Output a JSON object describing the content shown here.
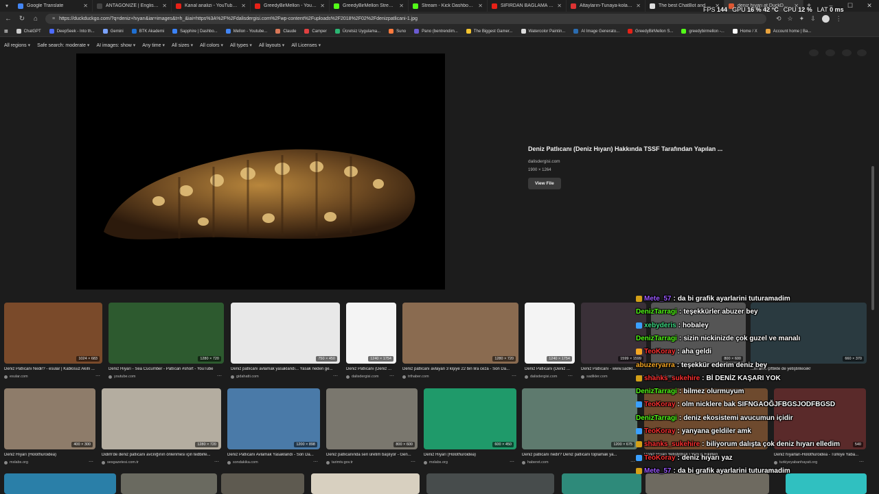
{
  "tabs": [
    {
      "label": "Google Translate",
      "color": "#4285f4"
    },
    {
      "label": "ANTAGONIZE | English meaning",
      "color": "#444"
    },
    {
      "label": "Kanal analizi - YouTube Studio",
      "color": "#e62117"
    },
    {
      "label": "GreedyBirMellon - YouTube",
      "color": "#e62117"
    },
    {
      "label": "GreedyBirMellon Stream - Watch",
      "color": "#53fc18"
    },
    {
      "label": "Stream - Kick Dashboard",
      "color": "#53fc18"
    },
    {
      "label": "SIFIRDAN BAĞLAMA DERSLERİ",
      "color": "#e62117"
    },
    {
      "label": "Altayların-Tunaya-kolay-nota",
      "color": "#d33"
    },
    {
      "label": "The best ChatBot and Widgets f",
      "color": "#ddd"
    },
    {
      "label": "deniz hıyarı at DuckDuckGo",
      "color": "#de5833"
    }
  ],
  "address": {
    "url": "https://duckduckgo.com/?q=deniz+hıyarı&iar=images&t=h_&iai=https%3A%2F%2Fdalisdergisi.com%2Fwp-content%2Fuploads%2F2018%2F02%2Fdenizpatlicani-1.jpg"
  },
  "bookmarks": [
    {
      "label": "ChatGPT",
      "color": "#ccc"
    },
    {
      "label": "DeepSeek - Into th...",
      "color": "#4d6bfe"
    },
    {
      "label": "Gemini",
      "color": "#7aa2ff"
    },
    {
      "label": "BTK Akademi",
      "color": "#1f6fd1"
    },
    {
      "label": "Sapphire | Dashbo...",
      "color": "#3b82f6"
    },
    {
      "label": "Mellon - Youtube...",
      "color": "#4285f4"
    },
    {
      "label": "Claude",
      "color": "#d97757"
    },
    {
      "label": "Camper",
      "color": "#e04040"
    },
    {
      "label": "Ücretsiz Uygulama...",
      "color": "#2bb673"
    },
    {
      "label": "Suno",
      "color": "#ff7a3d"
    },
    {
      "label": "Pano (bentrendim...",
      "color": "#6b5bd2"
    },
    {
      "label": "The Biggest Gamer...",
      "color": "#f4c430"
    },
    {
      "label": "Watercolor Paintin...",
      "color": "#ddd"
    },
    {
      "label": "AI Image Generato...",
      "color": "#2b6cb0"
    },
    {
      "label": "GreedyBirMellon S...",
      "color": "#e62117"
    },
    {
      "label": "greedybirmellon -...",
      "color": "#53fc18"
    },
    {
      "label": "Home / X",
      "color": "#fff"
    },
    {
      "label": "Account home | Ba...",
      "color": "#e8a33d"
    }
  ],
  "filters": [
    "All regions",
    "Safe search: moderate",
    "AI images: show",
    "Any time",
    "All sizes",
    "All colors",
    "All types",
    "All layouts",
    "All Licenses"
  ],
  "preview": {
    "title": "Deniz Patlıcanı (Deniz Hıyarı) Hakkında TSSF Tarafından Yapılan ...",
    "domain": "dalisdergisi.com",
    "size": "1900 × 1264",
    "view_file": "View File"
  },
  "row1": [
    {
      "dims": "1024 × 683",
      "caption": "Deniz Patlıcanı Nedir? - esular | Kablosuz Akıllı ...",
      "source": "esular.com"
    },
    {
      "dims": "1280 × 720",
      "caption": "Deniz Hıyarı - Sea Cucumber - Patlıcan #short - YouTube",
      "source": "youtube.com"
    },
    {
      "dims": "750 × 450",
      "caption": "Deniz patlıcanı avlamak yasaklandı... Yasak neden ge...",
      "source": "gidahatti.com"
    },
    {
      "dims": "1240 × 1754",
      "caption": "Deniz Patlıcanı (Deniz ...",
      "source": "dalisdergisi.com"
    },
    {
      "dims": "1280 × 720",
      "caption": "Deniz patlıcanı avlayan 3 kişiye 22 bin lira ceza - Son Da...",
      "source": "trthaber.com"
    },
    {
      "dims": "1240 × 1754",
      "caption": "Deniz Patlıcanı (Deniz ...",
      "source": "dalisdergisi.com"
    },
    {
      "dims": "1599 × 1599",
      "caption": "Deniz Patlıcanı - www.sadikl...",
      "source": "sadikler.com"
    },
    {
      "dims": "800 × 600",
      "caption": "",
      "source": "lirzzet.com"
    },
    {
      "dims": "660 × 370",
      "caption": "...nı artık çiftlikte de yetiştirilecek!",
      "source": ""
    }
  ],
  "row2": [
    {
      "dims": "400 × 300",
      "caption": "Deniz Hıyarı (Holothuroidea)",
      "source": "mxlabs.org"
    },
    {
      "dims": "1280 × 720",
      "caption": "Didim'de deniz patlıcanı avcılığının önlenmesi için tedbirle...",
      "source": "sesgazetesi.com.tr"
    },
    {
      "dims": "1200 × 898",
      "caption": "Deniz Patlıcanı Avlamak Yasaklandı - Son Da...",
      "source": "sondakika.com"
    },
    {
      "dims": "800 × 600",
      "caption": "Deniz patlıcanında seri üretim başlıyor - Gen...",
      "source": "tarimtv.gov.tr"
    },
    {
      "dims": "600 × 450",
      "caption": "Deniz Hıyarı (Holothuroidea)",
      "source": "mxlabs.org"
    },
    {
      "dims": "1200 × 675",
      "caption": "Deniz patlıcanı nedir? Deniz patlıcanı toplamak ya...",
      "source": "haberet.com"
    },
    {
      "dims": "",
      "caption": "Deniz Hıyarı Yetiştirmek | Yeni iş Fikirleri",
      "source": ""
    },
    {
      "dims": "540",
      "caption": "Deniz hıyarları-Holothuroidea - Türkiye Yaba...",
      "source": "turkiyeyabanhayati.org"
    }
  ],
  "stats": {
    "fps_label": "FPS",
    "fps": "144",
    "gpu_label": "GPU",
    "gpu": "16 %",
    "gpu_temp": "42 °C",
    "cpu_label": "CPU",
    "cpu": "12 %",
    "lat_label": "LAT",
    "lat": "0 ms"
  },
  "chat": [
    {
      "user": "Mete_57",
      "sep": " : ",
      "msg": "da bi grafik ayarlarini tuturamadim",
      "color": "#9b59ff",
      "badge": "#d4a017"
    },
    {
      "user": "DenizTarragi",
      "sep": " : ",
      "msg": "teşekkürler abuzer bey",
      "color": "#53fc18",
      "badge": ""
    },
    {
      "user": "xebyderis",
      "sep": " : ",
      "msg": "hobaley",
      "color": "#3ddc84",
      "badge": "#3aa0ff"
    },
    {
      "user": "DenizTarragi",
      "sep": " : ",
      "msg": "sizin nickinizde çok guzel ve manalı",
      "color": "#53fc18",
      "badge": ""
    },
    {
      "user": "TeoKoray",
      "sep": " : ",
      "msg": "aha geldi",
      "color": "#ff3030",
      "badge": "#f5a623"
    },
    {
      "user": "abuzeryarra",
      "sep": " : ",
      "msg": "teşekkür ederim deniz bey",
      "color": "#f5a623",
      "badge": ""
    },
    {
      "user": "shanks_sukehire",
      "sep": " : ",
      "msg": "Bİ DENİZ KAŞARI YOK",
      "color": "#ff3030",
      "badge": "#d4a017"
    },
    {
      "user": "DenizTarragi",
      "sep": " : ",
      "msg": "bilmez olurmuyum",
      "color": "#53fc18",
      "badge": ""
    },
    {
      "user": "TeoKoray",
      "sep": " : ",
      "msg": "olm nicklere bak SIFNGAOĞJFBGSJODFBGSD",
      "color": "#ff3030",
      "badge": "#3aa0ff"
    },
    {
      "user": "DenizTarragi",
      "sep": " : ",
      "msg": "deniz ekosistemi avucumun içidir",
      "color": "#53fc18",
      "badge": ""
    },
    {
      "user": "TeoKoray",
      "sep": " : ",
      "msg": "yanyana geldiler amk",
      "color": "#ff3030",
      "badge": "#3aa0ff"
    },
    {
      "user": "shanks_sukehire",
      "sep": " : ",
      "msg": "biliyorum dalışta çok deniz hıyarı elledim",
      "color": "#ff3030",
      "badge": "#d4a017"
    },
    {
      "user": "TeoKoray",
      "sep": " : ",
      "msg": "deniz hıyarı yaz",
      "color": "#ff3030",
      "badge": "#3aa0ff"
    },
    {
      "user": "Mete_57",
      "sep": " : ",
      "msg": "da bi grafik ayarlarini tuturamadim",
      "color": "#9b59ff",
      "badge": "#d4a017"
    }
  ]
}
